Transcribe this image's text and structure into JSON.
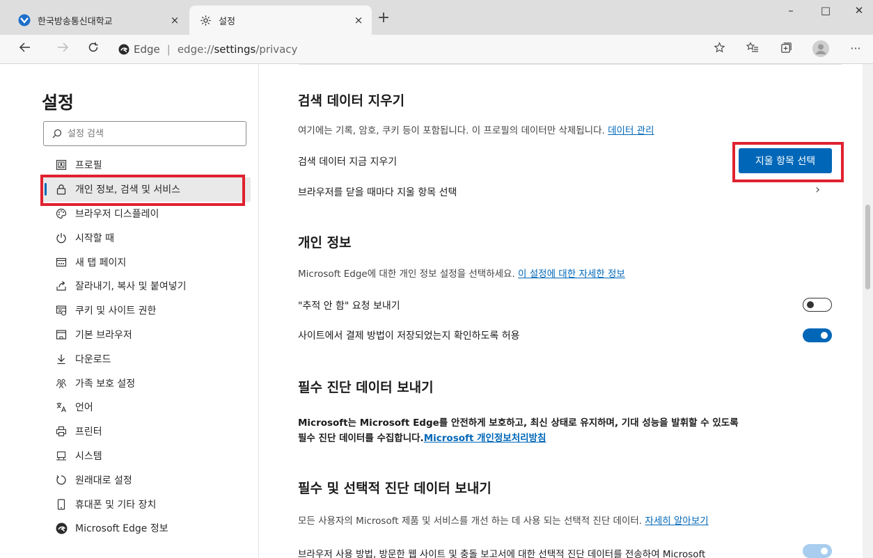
{
  "tabs": [
    {
      "title": "한국방송통신대학교",
      "favicon": "knou-favicon",
      "close": "×",
      "active": false
    },
    {
      "title": "설정",
      "favicon": "gear-icon",
      "close": "×",
      "active": true
    }
  ],
  "new_tab": "+",
  "window_controls": {
    "minimize": "–",
    "maximize": "□",
    "close": "✕"
  },
  "address_bar": {
    "brand": "Edge",
    "separator": "|",
    "url_host": "edge://",
    "url_path": "settings",
    "url_rest": "/privacy"
  },
  "toolbar": {
    "more": "···"
  },
  "sidebar": {
    "title": "설정",
    "search_placeholder": "설정 검색",
    "items": [
      {
        "label": "프로필",
        "icon": "profile-icon"
      },
      {
        "label": "개인 정보, 검색 및 서비스",
        "icon": "lock-icon",
        "selected": true
      },
      {
        "label": "브라우저 디스플레이",
        "icon": "palette-icon"
      },
      {
        "label": "시작할 때",
        "icon": "power-icon"
      },
      {
        "label": "새 탭 페이지",
        "icon": "newtab-page-icon"
      },
      {
        "label": "잘라내기, 복사 및 붙여넣기",
        "icon": "share-icon"
      },
      {
        "label": "쿠키 및 사이트 권한",
        "icon": "site-permissions-icon"
      },
      {
        "label": "기본 브라우저",
        "icon": "browser-window-icon"
      },
      {
        "label": "다운로드",
        "icon": "download-icon"
      },
      {
        "label": "가족 보호 설정",
        "icon": "family-icon"
      },
      {
        "label": "언어",
        "icon": "language-icon"
      },
      {
        "label": "프린터",
        "icon": "printer-icon"
      },
      {
        "label": "시스템",
        "icon": "system-icon"
      },
      {
        "label": "원래대로 설정",
        "icon": "reset-icon"
      },
      {
        "label": "휴대폰 및 기타 장치",
        "icon": "phone-icon"
      },
      {
        "label": "Microsoft Edge 정보",
        "icon": "edge-logo-icon"
      }
    ]
  },
  "clear_data": {
    "heading": "검색 데이터 지우기",
    "desc": "여기에는 기록, 암호, 쿠키 등이 포함됩니다. 이 프로필의 데이터만 삭제됩니다.",
    "desc_link": "데이터 관리",
    "now_label": "검색 데이터 지금 지우기",
    "choose_button": "지울 항목 선택",
    "on_close_label": "브라우저를 닫을 때마다 지울 항목 선택",
    "chevron": "›"
  },
  "privacy": {
    "heading": "개인 정보",
    "desc": "Microsoft Edge에 대한 개인 정보 설정을 선택하세요.",
    "desc_link": "이 설정에 대한 자세한 정보",
    "dnt_label": "\"추적 안 함\" 요청 보내기",
    "dnt_on": false,
    "payment_label": "사이트에서 결제 방법이 저장되었는지 확인하도록 허용",
    "payment_on": true
  },
  "required_diag": {
    "heading": "필수 진단 데이터 보내기",
    "line1": "Microsoft는 Microsoft Edge를 안전하게 보호하고, 최신 상태로 유지하며, 기대 성능을 발휘할 수 있도록",
    "line2": "필수 진단 데이터를 수집합니다.",
    "link": "Microsoft 개인정보처리방침"
  },
  "optional_diag": {
    "heading": "필수 및 선택적 진단 데이터 보내기",
    "desc": "모든 사용자의 Microsoft 제품 및 서비스를 개선 하는 데 사용 되는 선택적 진단 데이터.",
    "desc_link": "자세히 알아보기",
    "toggle_label": "브라우저 사용 방법, 방문한 웹 사이트 및 충돌 보고서에 대한 선택적 진단 데이터를 전송하여 Microsoft",
    "toggle_on": true,
    "toggle_disabled": true
  },
  "colors": {
    "accent": "#0067b8",
    "highlight_box": "#e0212f"
  }
}
